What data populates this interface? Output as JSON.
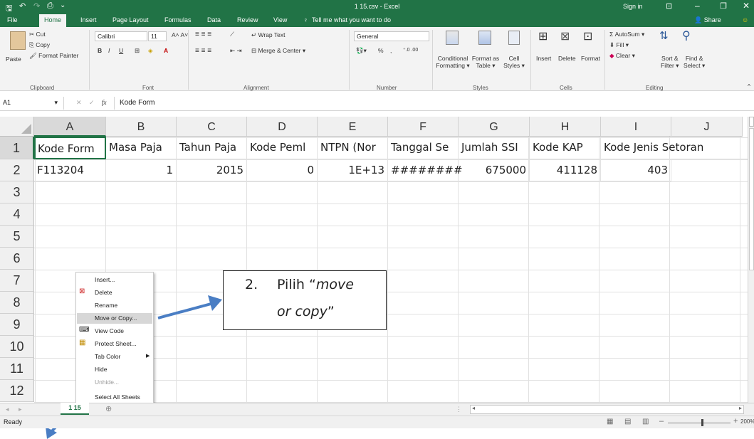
{
  "window": {
    "title": "1 15.csv  -  Excel",
    "sign_in": "Sign in",
    "share": "Share"
  },
  "tabs": [
    "File",
    "Home",
    "Insert",
    "Page Layout",
    "Formulas",
    "Data",
    "Review",
    "View"
  ],
  "tell_me": "Tell me what you want to do",
  "ribbon": {
    "clipboard": {
      "paste": "Paste",
      "cut": "Cut",
      "copy": "Copy",
      "format_painter": "Format Painter",
      "label": "Clipboard"
    },
    "font": {
      "name": "Calibri",
      "size": "11",
      "bold": "B",
      "italic": "I",
      "underline": "U",
      "label": "Font"
    },
    "alignment": {
      "wrap": "Wrap Text",
      "merge": "Merge & Center",
      "label": "Alignment"
    },
    "number": {
      "format": "General",
      "percent": "%",
      "comma": ",",
      "label": "Number"
    },
    "styles": {
      "conditional": "Conditional",
      "conditional2": "Formatting",
      "format_as": "Format as",
      "format_as2": "Table",
      "cell": "Cell",
      "cell2": "Styles",
      "label": "Styles"
    },
    "cells": {
      "insert": "Insert",
      "delete": "Delete",
      "format": "Format",
      "label": "Cells"
    },
    "editing": {
      "autosum": "AutoSum",
      "fill": "Fill",
      "clear": "Clear",
      "sort": "Sort &",
      "sort2": "Filter",
      "find": "Find &",
      "find2": "Select",
      "label": "Editing"
    }
  },
  "formula_bar": {
    "name_box": "A1",
    "fx": "fx",
    "value": "Kode Form"
  },
  "columns": [
    "A",
    "B",
    "C",
    "D",
    "E",
    "F",
    "G",
    "H",
    "I",
    "J"
  ],
  "rows": [
    "1",
    "2",
    "3",
    "4",
    "5",
    "6",
    "7",
    "8",
    "9",
    "10",
    "11",
    "12"
  ],
  "row1": [
    "Kode Form",
    "Masa Paja",
    "Tahun Paja",
    "Kode Peml",
    "NTPN (Nor",
    "Tanggal Se",
    "Jumlah SSI",
    "Kode KAP",
    "Kode Jenis Setoran"
  ],
  "row2": [
    "F113204",
    "1",
    "2015",
    "0",
    "1E+13",
    "########",
    "675000",
    "411128",
    "403"
  ],
  "context_menu": [
    "Insert...",
    "Delete",
    "Rename",
    "Move or Copy...",
    "View Code",
    "Protect Sheet...",
    "Tab Color",
    "Hide",
    "Unhide...",
    "Select All Sheets"
  ],
  "callout": {
    "number": "2.",
    "text_a": "Pilih “",
    "italic": "move",
    "italic2": "or copy",
    "text_b": "”"
  },
  "sheet_tab": "1 15",
  "status": {
    "ready": "Ready",
    "zoom": "200%"
  },
  "colors": {
    "excel_green": "#217346",
    "arrow": "#4a7ec4",
    "highlight": "#d7d7d7"
  }
}
